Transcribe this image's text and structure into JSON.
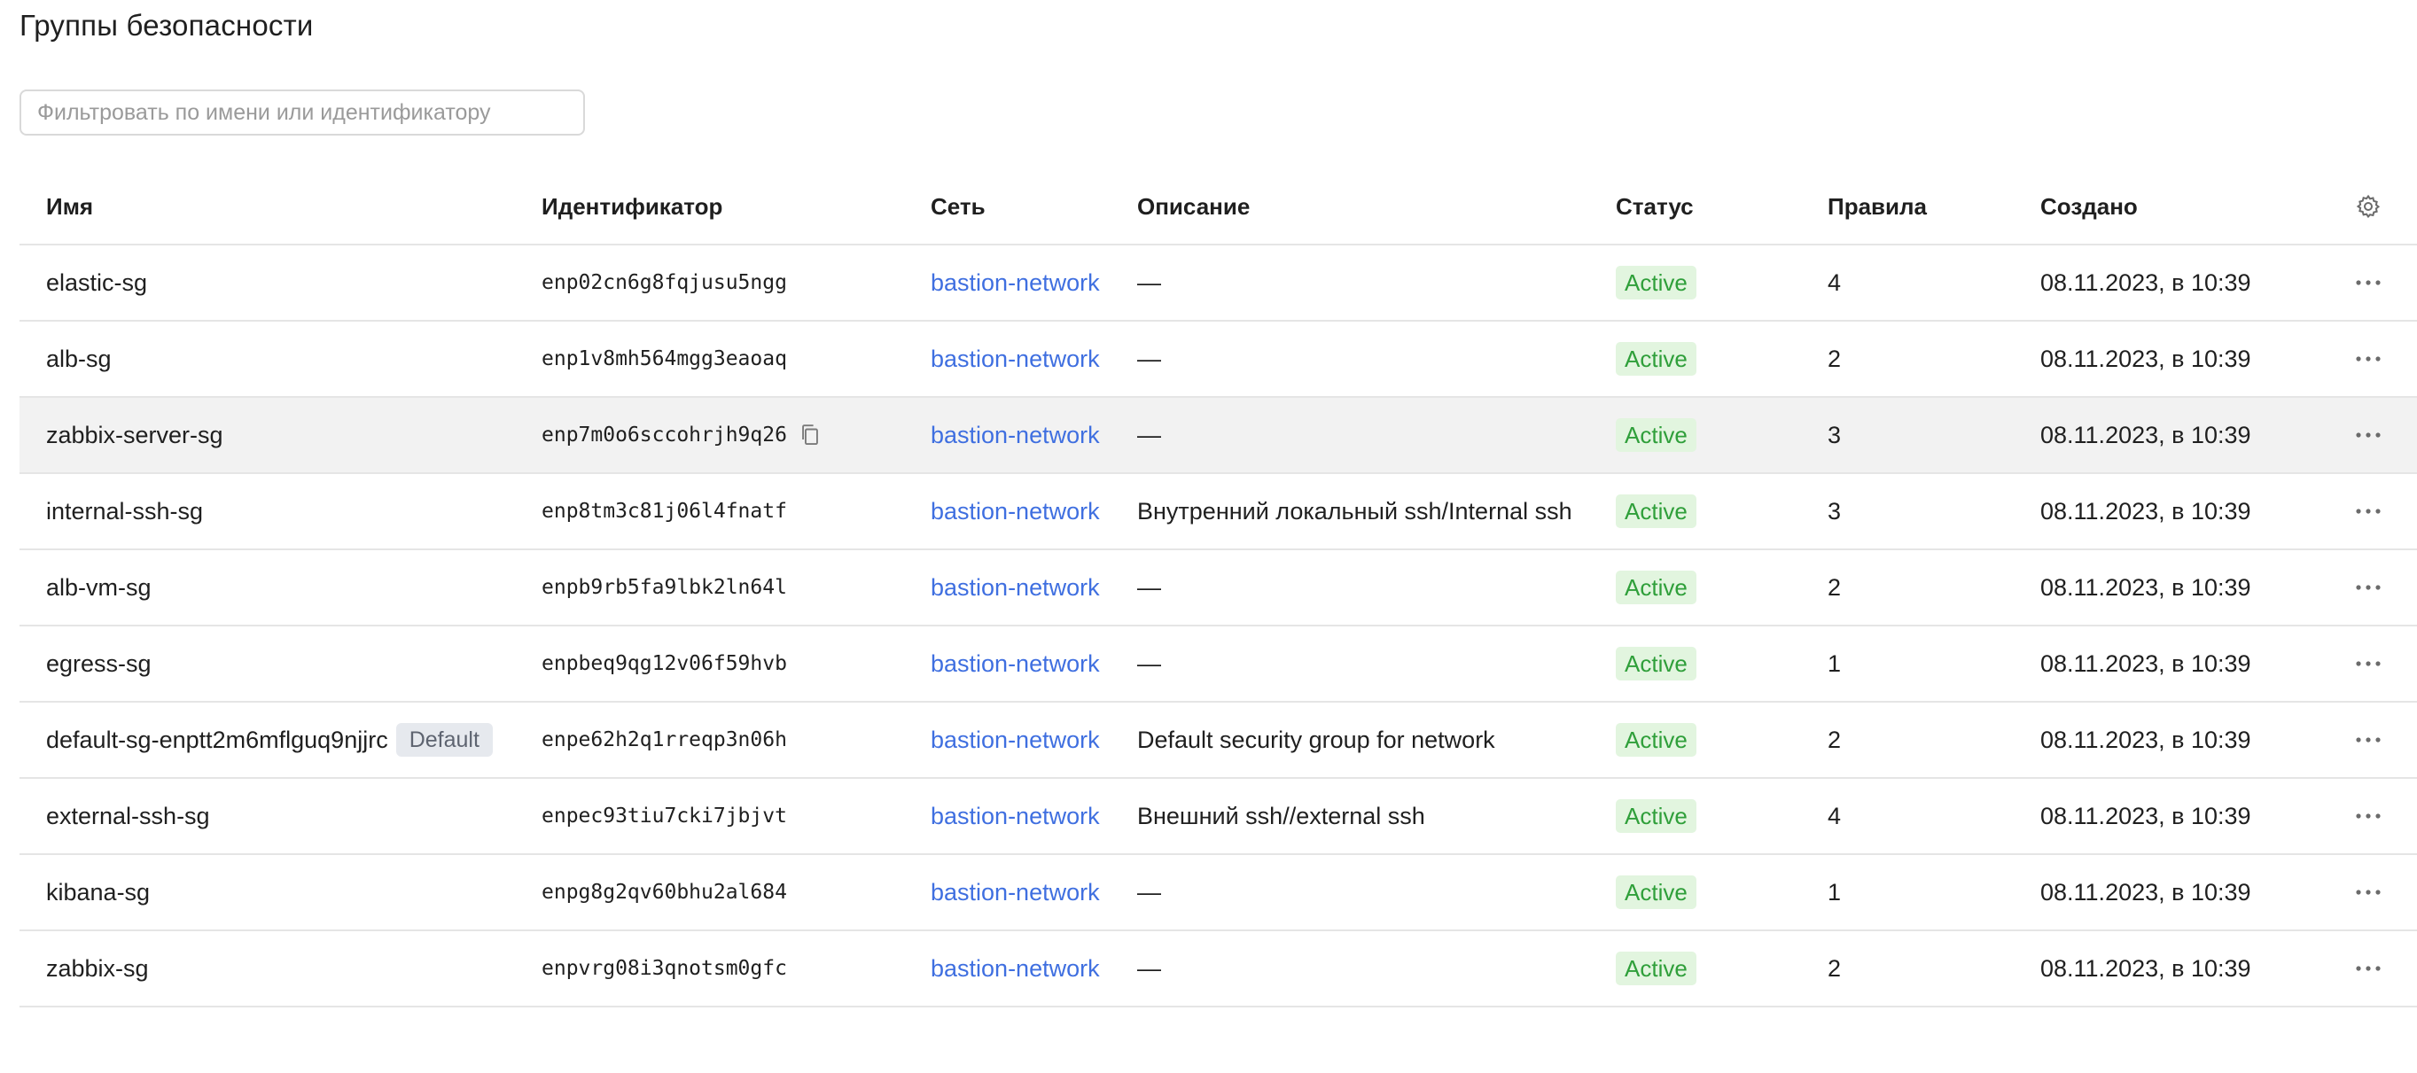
{
  "page": {
    "title": "Группы безопасности",
    "filter_placeholder": "Фильтровать по имени или идентификатору"
  },
  "table": {
    "columns": {
      "name": "Имя",
      "id": "Идентификатор",
      "network": "Сеть",
      "description": "Описание",
      "status": "Статус",
      "rules": "Правила",
      "created": "Создано"
    },
    "settings_icon": "gear-icon",
    "row_menu_icon": "ellipsis-icon",
    "copy_icon": "copy-icon",
    "hovered_row_index": 2,
    "colors": {
      "link": "#3f6fe0",
      "status_active_bg": "#e2f5df",
      "status_active_text": "#2f9f3a",
      "hover_row_bg": "#f2f2f2"
    },
    "rows": [
      {
        "name": "elastic-sg",
        "badge": "",
        "id": "enp02cn6g8fqjusu5ngg",
        "network": "bastion-network",
        "description": "—",
        "status": "Active",
        "rules": "4",
        "created": "08.11.2023, в 10:39"
      },
      {
        "name": "alb-sg",
        "badge": "",
        "id": "enp1v8mh564mgg3eaoaq",
        "network": "bastion-network",
        "description": "—",
        "status": "Active",
        "rules": "2",
        "created": "08.11.2023, в 10:39"
      },
      {
        "name": "zabbix-server-sg",
        "badge": "",
        "id": "enp7m0o6sccohrjh9q26",
        "network": "bastion-network",
        "description": "—",
        "status": "Active",
        "rules": "3",
        "created": "08.11.2023, в 10:39"
      },
      {
        "name": "internal-ssh-sg",
        "badge": "",
        "id": "enp8tm3c81j06l4fnatf",
        "network": "bastion-network",
        "description": "Внутренний локальный ssh/Internal ssh",
        "status": "Active",
        "rules": "3",
        "created": "08.11.2023, в 10:39"
      },
      {
        "name": "alb-vm-sg",
        "badge": "",
        "id": "enpb9rb5fa9lbk2ln64l",
        "network": "bastion-network",
        "description": "—",
        "status": "Active",
        "rules": "2",
        "created": "08.11.2023, в 10:39"
      },
      {
        "name": "egress-sg",
        "badge": "",
        "id": "enpbeq9qg12v06f59hvb",
        "network": "bastion-network",
        "description": "—",
        "status": "Active",
        "rules": "1",
        "created": "08.11.2023, в 10:39"
      },
      {
        "name": "default-sg-enptt2m6mflguq9njjrc",
        "badge": "Default",
        "id": "enpe62h2q1rreqp3n06h",
        "network": "bastion-network",
        "description": "Default security group for network",
        "status": "Active",
        "rules": "2",
        "created": "08.11.2023, в 10:39"
      },
      {
        "name": "external-ssh-sg",
        "badge": "",
        "id": "enpec93tiu7cki7jbjvt",
        "network": "bastion-network",
        "description": "Внешний ssh//external ssh",
        "status": "Active",
        "rules": "4",
        "created": "08.11.2023, в 10:39"
      },
      {
        "name": "kibana-sg",
        "badge": "",
        "id": "enpg8g2qv60bhu2al684",
        "network": "bastion-network",
        "description": "—",
        "status": "Active",
        "rules": "1",
        "created": "08.11.2023, в 10:39"
      },
      {
        "name": "zabbix-sg",
        "badge": "",
        "id": "enpvrg08i3qnotsm0gfc",
        "network": "bastion-network",
        "description": "—",
        "status": "Active",
        "rules": "2",
        "created": "08.11.2023, в 10:39"
      }
    ]
  }
}
